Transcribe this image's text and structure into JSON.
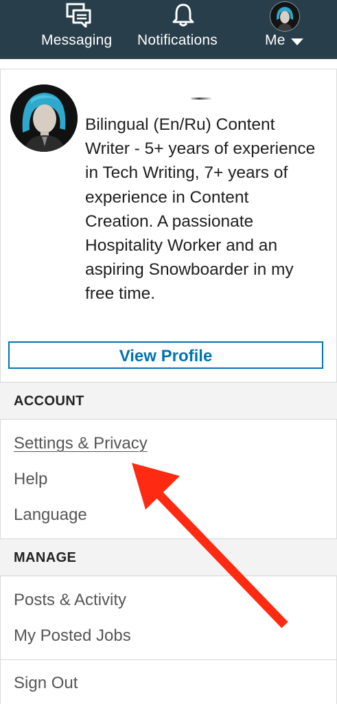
{
  "nav": {
    "messaging_label": "Messaging",
    "notifications_label": "Notifications",
    "me_label": "Me"
  },
  "profile": {
    "headline": "Bilingual (En/Ru) Content Writer - 5+ years of experience in Tech Writing, 7+ years of experience in Content Creation. A passionate Hospitality Worker and an aspiring Snowboarder in my free time.",
    "view_profile_label": "View Profile"
  },
  "account": {
    "title": "ACCOUNT",
    "items": [
      "Settings & Privacy",
      "Help",
      "Language"
    ]
  },
  "manage": {
    "title": "MANAGE",
    "items": [
      "Posts & Activity",
      "My Posted Jobs"
    ]
  },
  "sign_out_label": "Sign Out",
  "colors": {
    "nav_bg": "#283e4a",
    "link_blue": "#0073b1",
    "annotation_arrow": "#ff2a12",
    "section_bg": "#f3f3f3"
  }
}
